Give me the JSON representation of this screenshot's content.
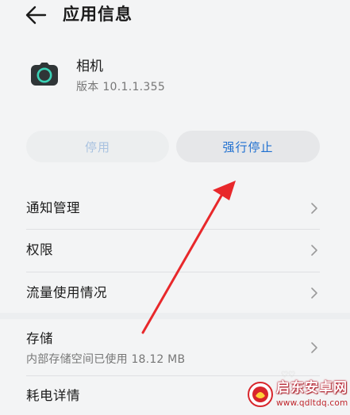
{
  "header": {
    "title": "应用信息",
    "back_icon": "arrow-left-icon"
  },
  "app": {
    "icon": "camera-icon",
    "name": "相机",
    "version": "版本 10.1.1.355"
  },
  "actions": {
    "disable_label": "停用",
    "force_stop_label": "强行停止"
  },
  "settings": {
    "items": [
      {
        "label": "通知管理"
      },
      {
        "label": "权限"
      },
      {
        "label": "流量使用情况"
      },
      {
        "label": "存储",
        "sub": "内部存储空间已使用 18.12 MB"
      },
      {
        "label": "耗电详情"
      }
    ]
  },
  "watermark": {
    "logo_icon": "qidong-logo-icon",
    "title": "启东安卓网",
    "url": "www.qdltdq.com"
  },
  "colors": {
    "accent": "#1e6fd0",
    "disabled_text": "#a9c2e0",
    "annotation_arrow": "#e8282b",
    "app_icon_bg": "#2f3537",
    "app_icon_lens": "#3ad1b5",
    "background": "#f3f4f5"
  }
}
